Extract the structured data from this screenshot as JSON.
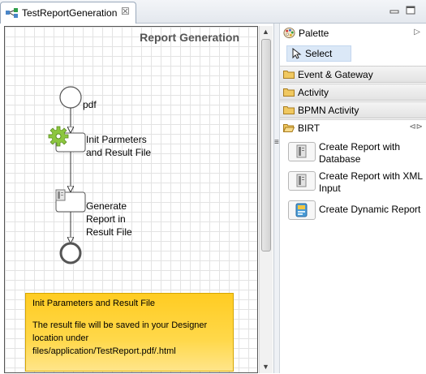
{
  "editor": {
    "tab_label": "TestReportGeneration",
    "close_glyph": "☒"
  },
  "diagram": {
    "title": "Report Generation",
    "start_label": "pdf",
    "task1_label_line1": "Init Parmeters",
    "task1_label_line2": "and Result File",
    "task2_label_line1": "Generate",
    "task2_label_line2": "Report in",
    "task2_label_line3": "Result File",
    "note_title": "Init Parameters and Result File",
    "note_text": "The result file will be saved in your Designer location under files/application/TestReport.pdf/.html"
  },
  "palette": {
    "title": "Palette",
    "select_label": "Select",
    "drawers": [
      {
        "label": "Event & Gateway",
        "icon": "folder-icon",
        "expanded": false
      },
      {
        "label": "Activity",
        "icon": "folder-icon",
        "expanded": false
      },
      {
        "label": "BPMN Activity",
        "icon": "folder-icon",
        "expanded": false
      },
      {
        "label": "BIRT",
        "icon": "folder-icon",
        "expanded": true
      }
    ],
    "birt_tools": [
      {
        "label": "Create Report with Database",
        "icon": "report-database-icon"
      },
      {
        "label": "Create Report with XML Input",
        "icon": "report-xml-icon"
      },
      {
        "label": "Create Dynamic Report",
        "icon": "dynamic-report-icon"
      }
    ]
  },
  "colors": {
    "note_background": "#ffcc22",
    "selection": "#dbe8f7",
    "gear": "#8cc63f",
    "folder": "#e8b84a"
  }
}
